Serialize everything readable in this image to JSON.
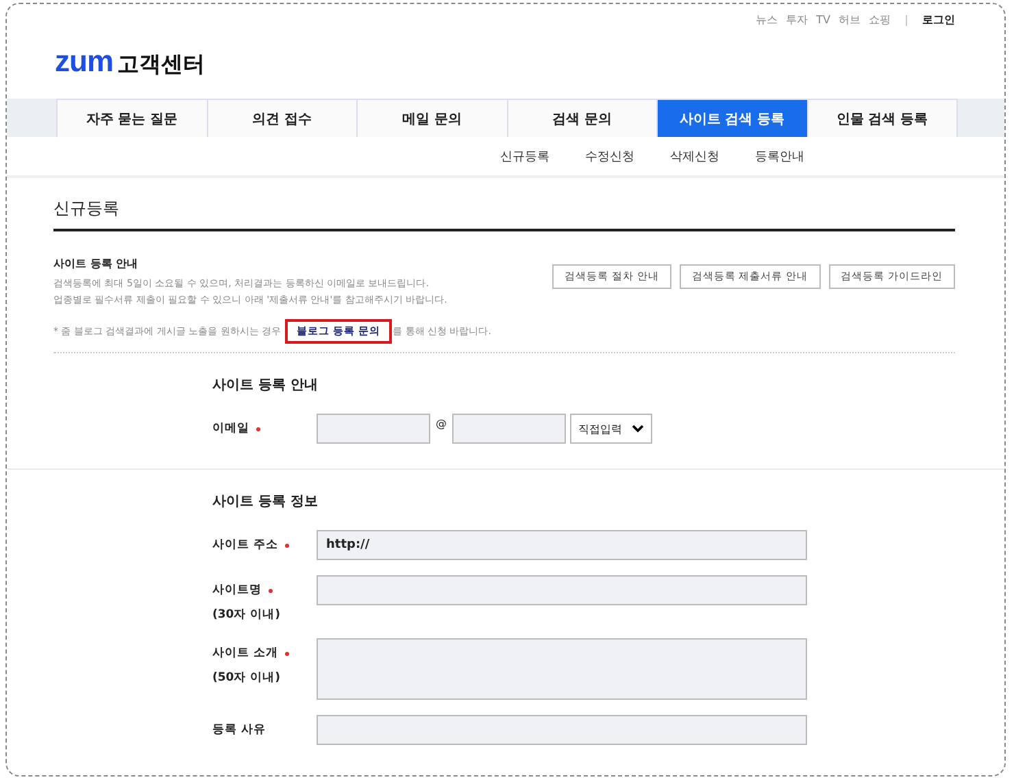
{
  "top_links": [
    "뉴스",
    "투자",
    "TV",
    "허브",
    "쇼핑"
  ],
  "login": "로그인",
  "logo": {
    "brand": "zum",
    "title": "고객센터"
  },
  "tabs": [
    {
      "label": "자주 묻는 질문",
      "selected": false
    },
    {
      "label": "의견 접수",
      "selected": false
    },
    {
      "label": "메일 문의",
      "selected": false
    },
    {
      "label": "검색 문의",
      "selected": false
    },
    {
      "label": "사이트 검색 등록",
      "selected": true
    },
    {
      "label": "인물 검색 등록",
      "selected": false
    }
  ],
  "subtabs": [
    "신규등록",
    "수정신청",
    "삭제신청",
    "등록안내"
  ],
  "page_title": "신규등록",
  "guide": {
    "title": "사이트 등록 안내",
    "lines": [
      "검색등록에 최대 5일이 소요될 수 있으며, 처리결과는 등록하신 이메일로 보내드립니다.",
      "업종별로 필수서류 제출이 필요할 수 있으니 아래 '제출서류 안내'를 참고해주시기 바랍니다."
    ],
    "buttons": [
      "검색등록 절차 안내",
      "검색등록 제출서류 안내",
      "검색등록 가이드라인"
    ],
    "notice": {
      "before": "* 줌 블로그 검색결과에 게시글 노출을 원하시는 경우",
      "link": "블로그 등록 문의",
      "after": "를 통해 신청 바랍니다.",
      "highlighted": true
    }
  },
  "sections": [
    {
      "title": "사이트 등록 안내",
      "rows": [
        {
          "kind": "email",
          "label": "이메일",
          "required": true,
          "at": "@",
          "select": "직접입력"
        }
      ]
    },
    {
      "title": "사이트 등록 정보",
      "rows": [
        {
          "kind": "input",
          "label": "사이트 주소",
          "required": true,
          "value": "http://"
        },
        {
          "kind": "input",
          "label": "사이트명",
          "required": true,
          "note": "(30자 이내)"
        },
        {
          "kind": "textarea",
          "label": "사이트 소개",
          "required": true,
          "note": "(50자 이내)"
        },
        {
          "kind": "input",
          "label": "등록 사유",
          "required": false
        }
      ]
    }
  ]
}
